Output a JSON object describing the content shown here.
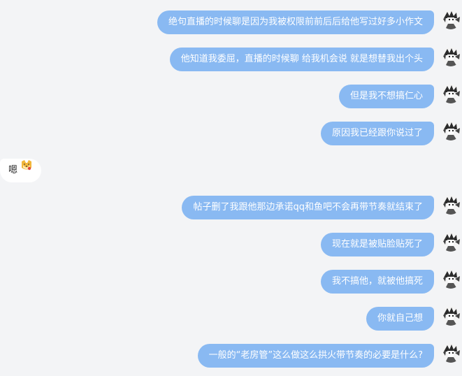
{
  "messages": [
    {
      "side": "sent",
      "text": "绝句直播的时候聊是因为我被权限前前后后给他写过好多小作文"
    },
    {
      "side": "sent",
      "text": "他知道我委屈，直播的时候聊 给我机会说 就是想替我出个头"
    },
    {
      "side": "sent",
      "text": "但是我不想搞仁心"
    },
    {
      "side": "sent",
      "text": "原因我已经跟你说过了"
    },
    {
      "side": "received",
      "text": "嗯",
      "emoji": "cat-face-emoji-icon"
    },
    {
      "side": "sent",
      "text": "帖子删了我跟他那边承诺qq和鱼吧不会再带节奏就结束了"
    },
    {
      "side": "sent",
      "text": "现在就是被贴脸贴死了"
    },
    {
      "side": "sent",
      "text": "我不搞他，就被他搞死"
    },
    {
      "side": "sent",
      "text": "你就自己想"
    },
    {
      "side": "sent",
      "text": "一般的“老房管”这么做这么拱火带节奏的必要是什么?"
    }
  ],
  "colors": {
    "background": "#f3f4f6",
    "sent_bubble": "#89b9f2",
    "sent_text": "#ffffff",
    "received_bubble": "#ffffff",
    "received_text": "#222222"
  },
  "icons": {
    "avatar": "anime-avatar-icon",
    "emoji": "cat-face-emoji-icon"
  }
}
